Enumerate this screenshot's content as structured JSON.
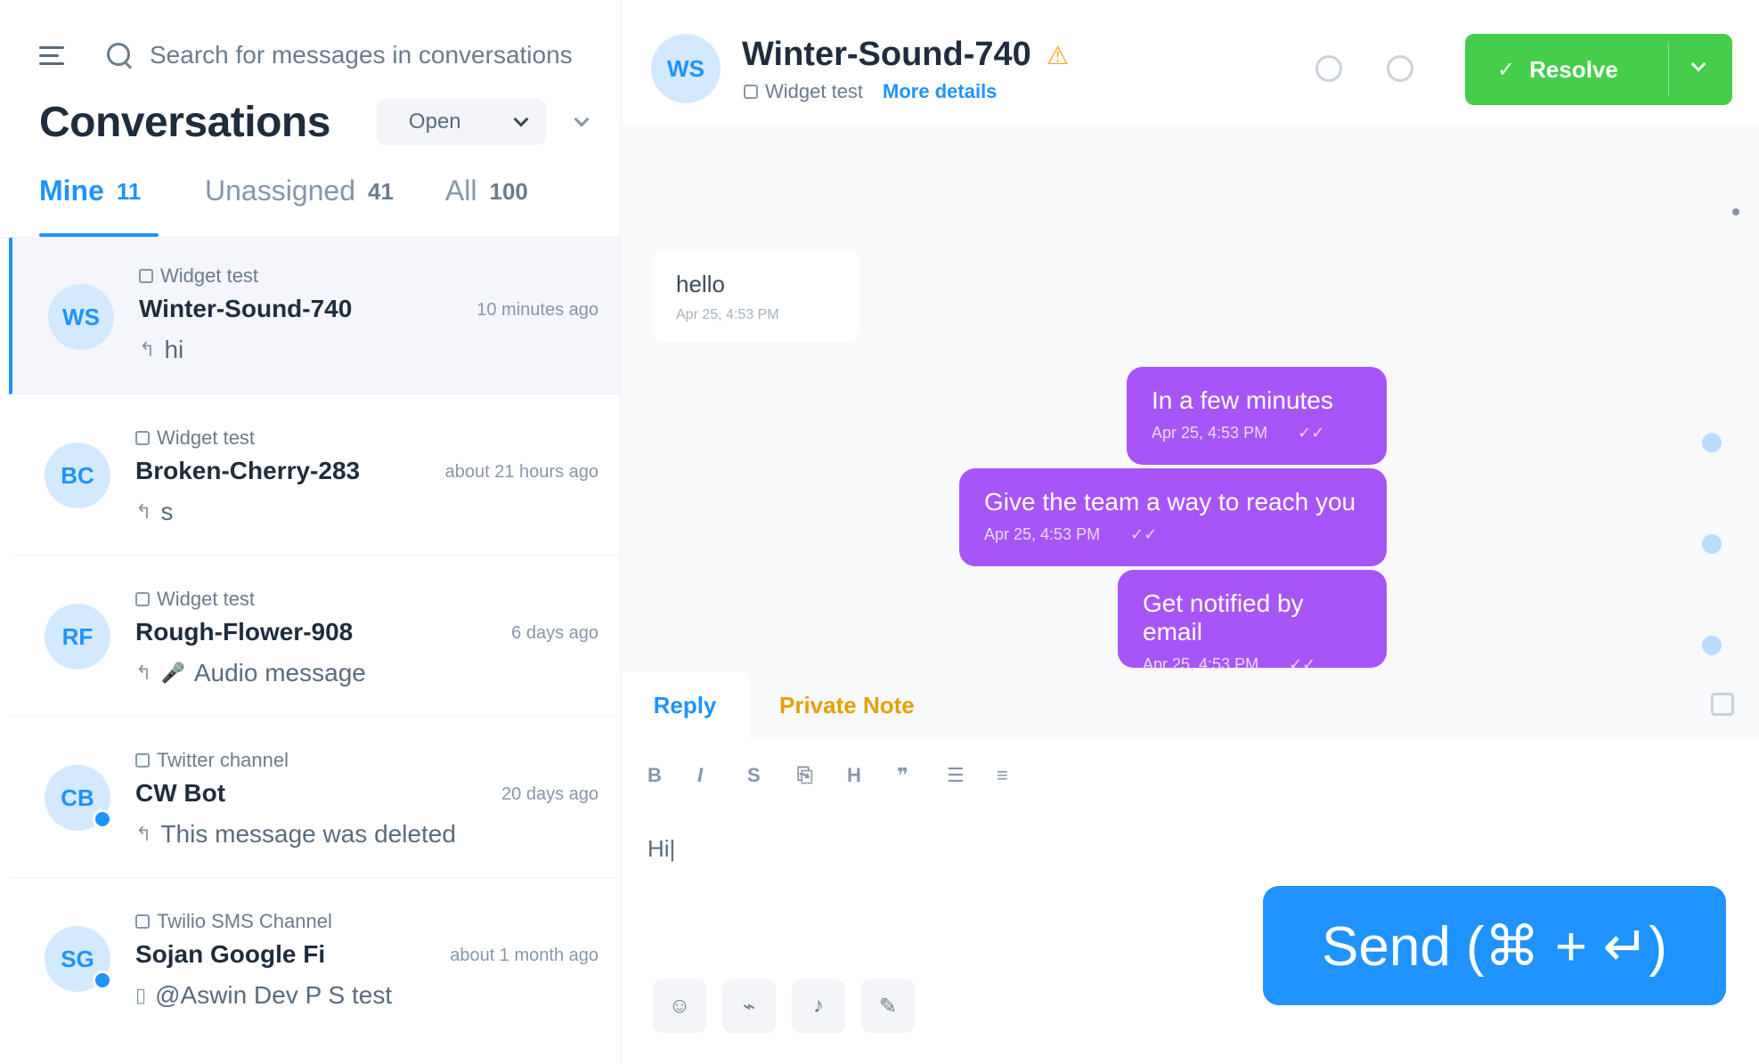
{
  "sidebar": {
    "search_placeholder": "Search for messages in conversations",
    "title": "Conversations",
    "status_filter": "Open",
    "tabs": [
      {
        "label": "Mine",
        "count": "11"
      },
      {
        "label": "Unassigned",
        "count": "41"
      },
      {
        "label": "All",
        "count": "100"
      }
    ],
    "conversations": [
      {
        "inbox": "Widget test",
        "initials": "WS",
        "name": "Winter-Sound-740",
        "time": "10 minutes ago",
        "message": "hi",
        "badge": false
      },
      {
        "inbox": "Widget test",
        "initials": "BC",
        "name": "Broken-Cherry-283",
        "time": "about 21 hours ago",
        "message": "s",
        "badge": false
      },
      {
        "inbox": "Widget test",
        "initials": "RF",
        "name": "Rough-Flower-908",
        "time": "6 days ago",
        "message": "Audio message",
        "badge": false
      },
      {
        "inbox": "Twitter channel",
        "initials": "CB",
        "name": "CW Bot",
        "time": "20 days ago",
        "message": "This message was deleted",
        "badge": true
      },
      {
        "inbox": "Twilio SMS Channel",
        "initials": "SG",
        "name": "Sojan Google Fi",
        "time": "about 1 month ago",
        "message": "@Aswin Dev P S test",
        "badge": true
      }
    ]
  },
  "header": {
    "initials": "WS",
    "contact_name": "Winter-Sound-740",
    "inbox": "Widget test",
    "more_details": "More details",
    "resolve_label": "Resolve"
  },
  "messages": {
    "incoming": {
      "text": "hello",
      "meta": "Apr 25, 4:53 PM"
    },
    "outgoing": [
      {
        "text": "In a few minutes",
        "meta": "Apr 25, 4:53 PM"
      },
      {
        "text": "Give the team a way to reach you",
        "meta": "Apr 25, 4:53 PM"
      },
      {
        "text": "Get notified by email",
        "meta": "Apr 25, 4:53 PM"
      }
    ]
  },
  "reply": {
    "tab_reply": "Reply",
    "tab_note": "Private Note",
    "editor_text": "Hi|",
    "send_label": "Send (⌘ + ↵)"
  },
  "colors": {
    "primary": "#1f93ff",
    "resolve": "#44ce4b",
    "outgoing_bubble": "#a855f7",
    "warning": "#f5a623"
  }
}
